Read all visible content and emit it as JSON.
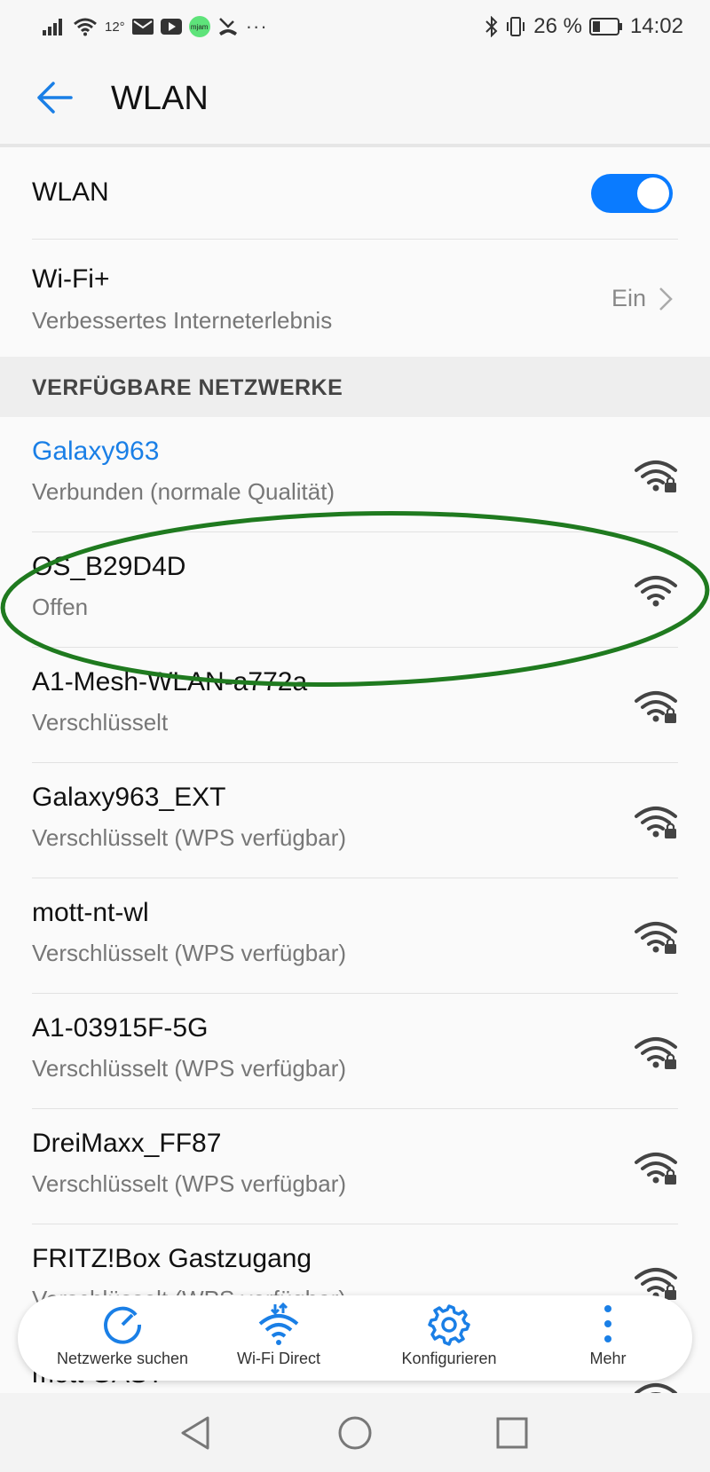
{
  "status_bar": {
    "temperature": "12°",
    "app_badge": "mjam",
    "more": "···",
    "battery": "26 %",
    "time": "14:02"
  },
  "header": {
    "title": "WLAN"
  },
  "wlan_toggle": {
    "label": "WLAN",
    "on": true
  },
  "wifi_plus": {
    "title": "Wi-Fi+",
    "subtitle": "Verbessertes Interneterlebnis",
    "value": "Ein"
  },
  "section_title": "VERFÜGBARE NETZWERKE",
  "networks": [
    {
      "name": "Galaxy963",
      "status": "Verbunden (normale Qualität)",
      "secured": true,
      "connected": true
    },
    {
      "name": "OS_B29D4D",
      "status": "Offen",
      "secured": false,
      "connected": false
    },
    {
      "name": "A1-Mesh-WLAN-a772a",
      "status": "Verschlüsselt",
      "secured": true,
      "connected": false
    },
    {
      "name": "Galaxy963_EXT",
      "status": "Verschlüsselt (WPS verfügbar)",
      "secured": true,
      "connected": false
    },
    {
      "name": "mott-nt-wl",
      "status": "Verschlüsselt (WPS verfügbar)",
      "secured": true,
      "connected": false
    },
    {
      "name": "A1-03915F-5G",
      "status": "Verschlüsselt (WPS verfügbar)",
      "secured": true,
      "connected": false
    },
    {
      "name": "DreiMaxx_FF87",
      "status": "Verschlüsselt (WPS verfügbar)",
      "secured": true,
      "connected": false
    },
    {
      "name": "FRITZ!Box Gastzugang",
      "status": "Verschlüsselt (WPS verfügbar)",
      "secured": true,
      "connected": false
    },
    {
      "name": "mott GAST",
      "status": "",
      "secured": true,
      "connected": false
    }
  ],
  "bottom_actions": [
    {
      "label": "Netzwerke suchen",
      "icon": "refresh-icon"
    },
    {
      "label": "Wi-Fi Direct",
      "icon": "wifi-direct-icon"
    },
    {
      "label": "Konfigurieren",
      "icon": "gear-icon"
    },
    {
      "label": "Mehr",
      "icon": "more-vertical-icon"
    }
  ],
  "annotation": {
    "color": "#1f7a1f",
    "highlighted_network": "OS_B29D4D"
  },
  "colors": {
    "accent": "#0a7bff",
    "link_blue": "#1a7fe6"
  }
}
